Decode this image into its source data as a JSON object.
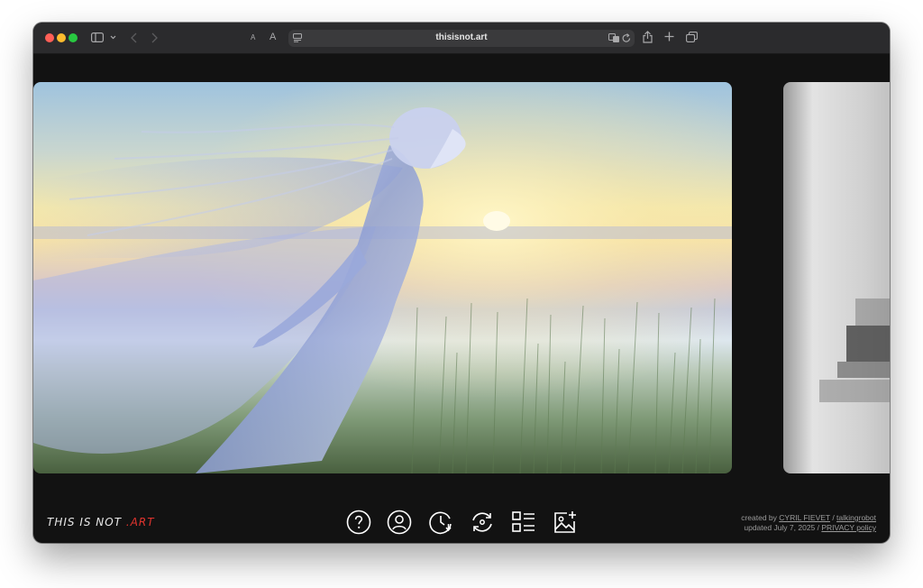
{
  "browser": {
    "url": "thisisnot.art",
    "text_small": "A",
    "text_large": "A",
    "icons": [
      "sidebar-icon",
      "chevron-down-icon",
      "back-icon",
      "forward-icon",
      "reader-icon",
      "translate-icon",
      "reload-icon",
      "share-icon",
      "new-tab-icon",
      "tab-overview-icon"
    ]
  },
  "site": {
    "logo_main": "THIS IS NOT ",
    "logo_accent": ".ART",
    "accent_color": "#e0342e",
    "nav_icons": [
      "help-icon",
      "user-icon",
      "history-icon",
      "shuffle-icon",
      "gallery-list-icon",
      "add-image-icon"
    ]
  },
  "credits": {
    "line1_prefix": "created by ",
    "author": "CYRIL FIEVET",
    "separator": " / ",
    "handle": "talkingrobot",
    "line2_prefix": "updated July 7, 2025 / ",
    "privacy": "PRIVACY policy"
  }
}
